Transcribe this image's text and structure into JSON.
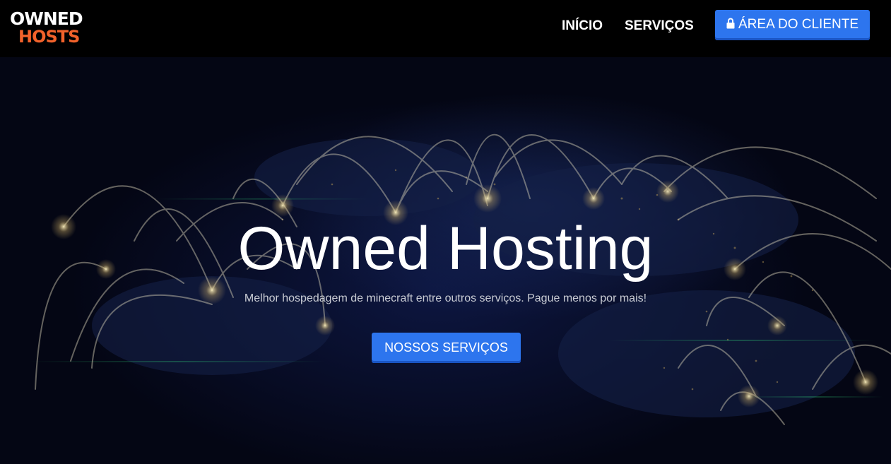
{
  "header": {
    "logo": {
      "line1": "OWNED",
      "line2": "HOSTS"
    },
    "nav": [
      {
        "label": "INÍCIO"
      },
      {
        "label": "SERVIÇOS"
      }
    ],
    "client_area": {
      "label": "ÁREA DO CLIENTE",
      "icon": "lock-icon"
    }
  },
  "hero": {
    "title": "Owned Hosting",
    "subtitle": "Melhor hospedagem de minecraft entre outros serviços. Pague menos por mais!",
    "cta_label": "NOSSOS SERVIÇOS",
    "background": "world-network-map"
  },
  "colors": {
    "accent": "#2d75ee",
    "brand_orange": "#f2622b",
    "header_bg": "#000000"
  }
}
